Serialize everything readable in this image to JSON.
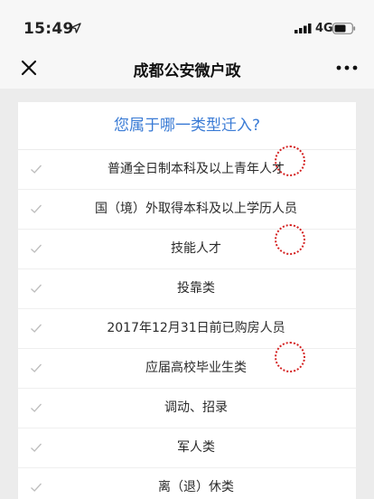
{
  "status_bar": {
    "time": "15:49",
    "network": "4G",
    "icons": [
      "location-arrow-icon",
      "signal-icon",
      "battery-icon"
    ]
  },
  "nav_bar": {
    "title": "成都公安微户政",
    "icons": [
      "close-icon",
      "more-icon"
    ]
  },
  "card": {
    "question": "您属于哪一类型迁入?",
    "options": [
      {
        "label": "普通全日制本科及以上青年人才",
        "circled": true
      },
      {
        "label": "国（境）外取得本科及以上学历人员",
        "circled": false
      },
      {
        "label": "技能人才",
        "circled": true
      },
      {
        "label": "投靠类",
        "circled": false
      },
      {
        "label": "2017年12月31日前已购房人员",
        "circled": false
      },
      {
        "label": "应届高校毕业生类",
        "circled": true
      },
      {
        "label": "调动、招录",
        "circled": false
      },
      {
        "label": "军人类",
        "circled": false
      },
      {
        "label": "离（退）休类",
        "circled": false
      }
    ]
  },
  "colors": {
    "accent": "#3a7bd5",
    "marker": "#d42020",
    "check": "#bdbdbd",
    "background": "#ececec"
  }
}
